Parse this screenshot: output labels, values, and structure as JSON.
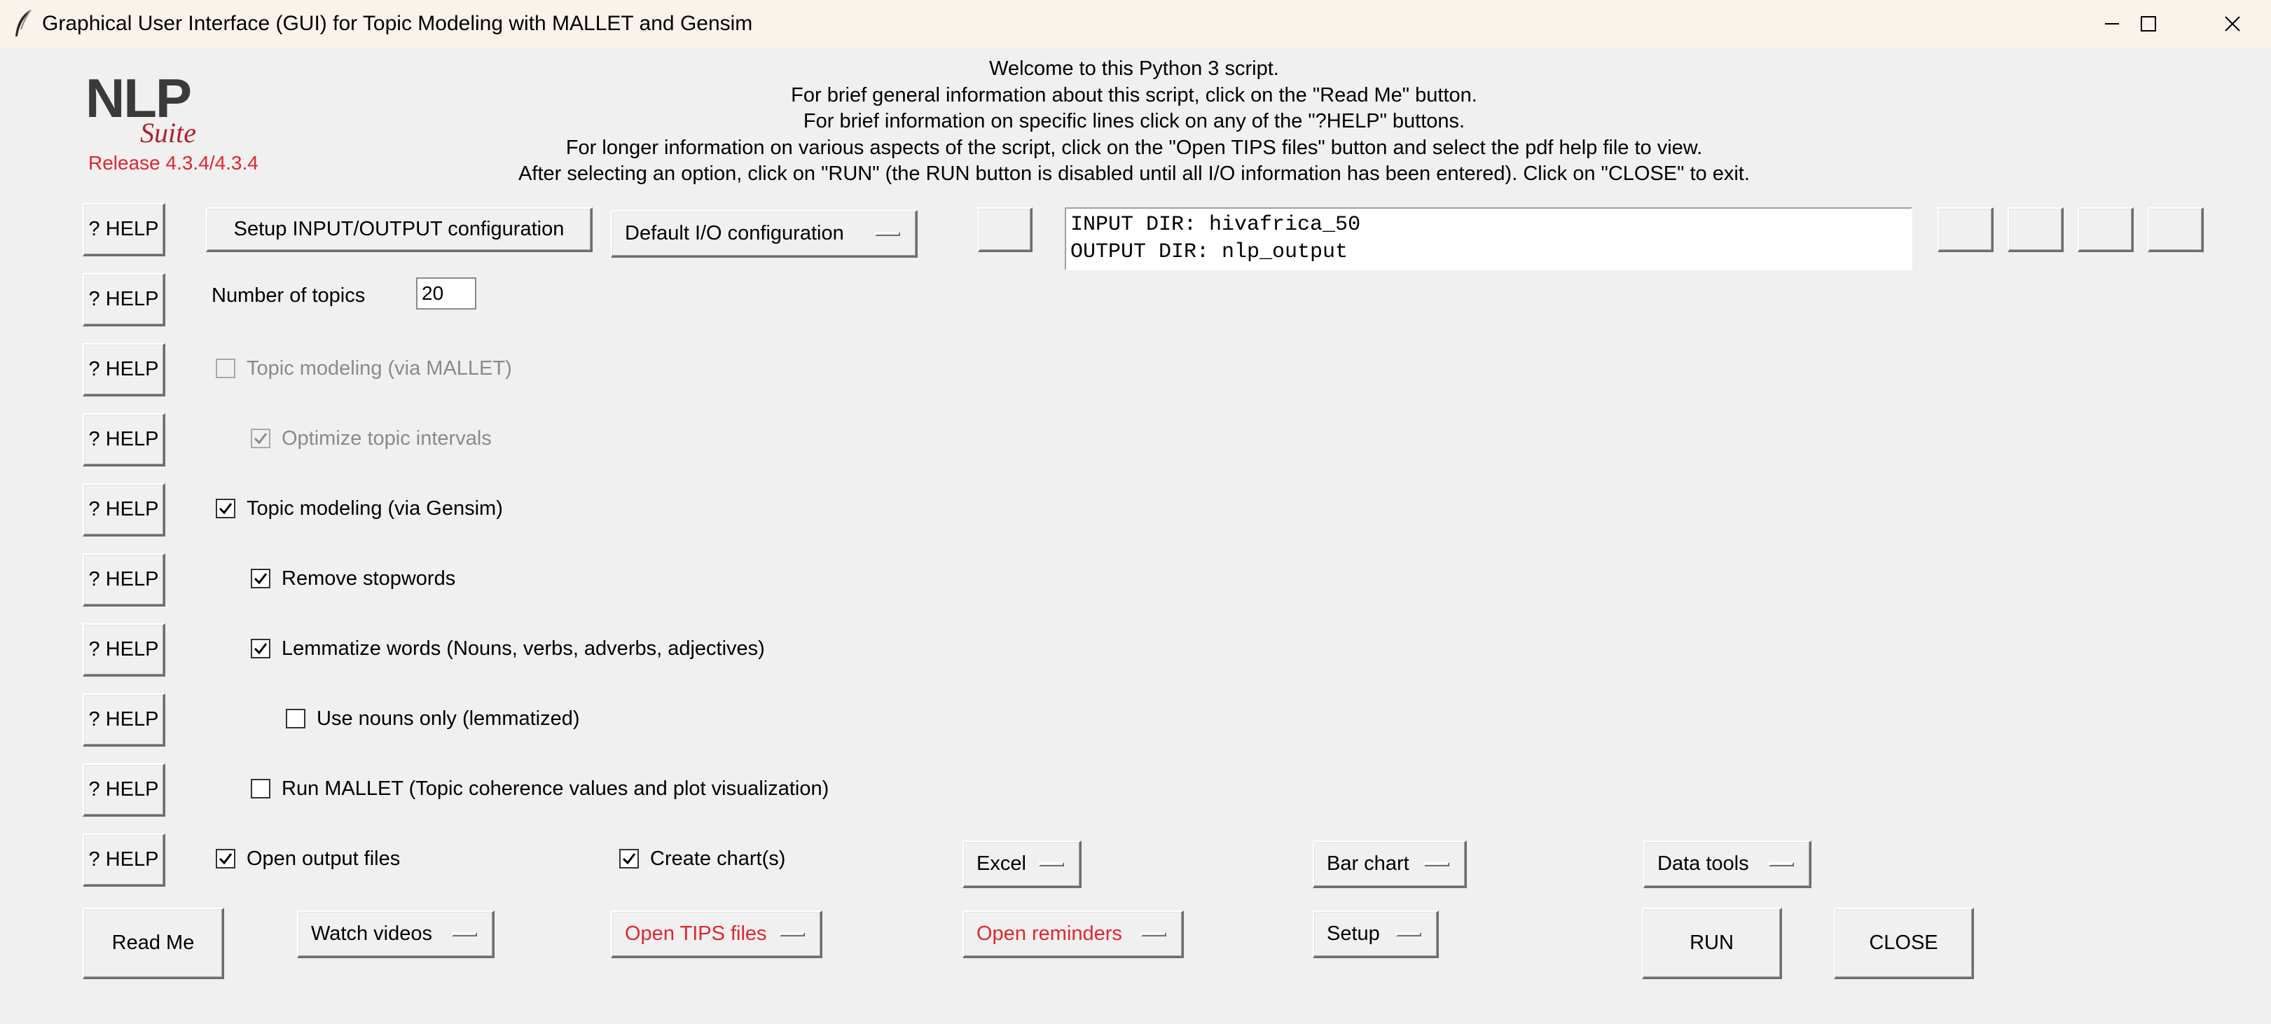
{
  "window": {
    "title": "Graphical User Interface (GUI) for Topic Modeling with MALLET and Gensim",
    "icon": "feather-icon",
    "controls": [
      "minimize-icon",
      "maximize-icon",
      "close-icon"
    ]
  },
  "logo": {
    "nlp": "NLP",
    "suite": "Suite",
    "release": "Release 4.3.4/4.3.4"
  },
  "welcome": {
    "lines": [
      "Welcome to this Python 3 script.",
      "For brief general information about this script, click on the \"Read Me\" button.",
      "For brief information on specific lines click on any of the \"?HELP\" buttons.",
      "For longer information on various aspects of the script, click on the \"Open TIPS files\" button and select the pdf help file to view.",
      "After selecting an option, click on \"RUN\" (the RUN button is disabled until all I/O information has been entered).   Click on \"CLOSE\" to exit."
    ]
  },
  "help_label": "? HELP",
  "io": {
    "setup_button": "Setup INPUT/OUTPUT configuration",
    "config_menu": "Default I/O configuration",
    "input_dir": "INPUT DIR: hivafrica_50",
    "output_dir": "OUTPUT DIR: nlp_output"
  },
  "options": {
    "num_topics_label": "Number of topics",
    "num_topics_value": "20",
    "mallet_label": "Topic modeling (via MALLET)",
    "mallet_checked": false,
    "optimize_label": "Optimize topic intervals",
    "optimize_checked": true,
    "gensim_label": "Topic modeling (via Gensim)",
    "gensim_checked": true,
    "stopwords_label": "Remove stopwords",
    "stopwords_checked": true,
    "lemmatize_label": "Lemmatize words (Nouns, verbs, adverbs, adjectives)",
    "lemmatize_checked": true,
    "nouns_label": "Use nouns only (lemmatized)",
    "nouns_checked": false,
    "run_mallet_label": "Run MALLET (Topic coherence values and plot visualization)",
    "run_mallet_checked": false,
    "open_output_label": "Open output files",
    "open_output_checked": true,
    "create_charts_label": "Create chart(s)",
    "create_charts_checked": true
  },
  "menus": {
    "excel": "Excel",
    "bar_chart": "Bar chart",
    "data_tools": "Data tools",
    "watch_videos": "Watch videos",
    "open_tips": "Open TIPS files",
    "open_reminders": "Open reminders",
    "setup": "Setup"
  },
  "buttons": {
    "read_me": "Read Me",
    "run": "RUN",
    "close": "CLOSE"
  },
  "colors": {
    "accent_red": "#e0262e",
    "window_bg": "#f0f0f0"
  }
}
